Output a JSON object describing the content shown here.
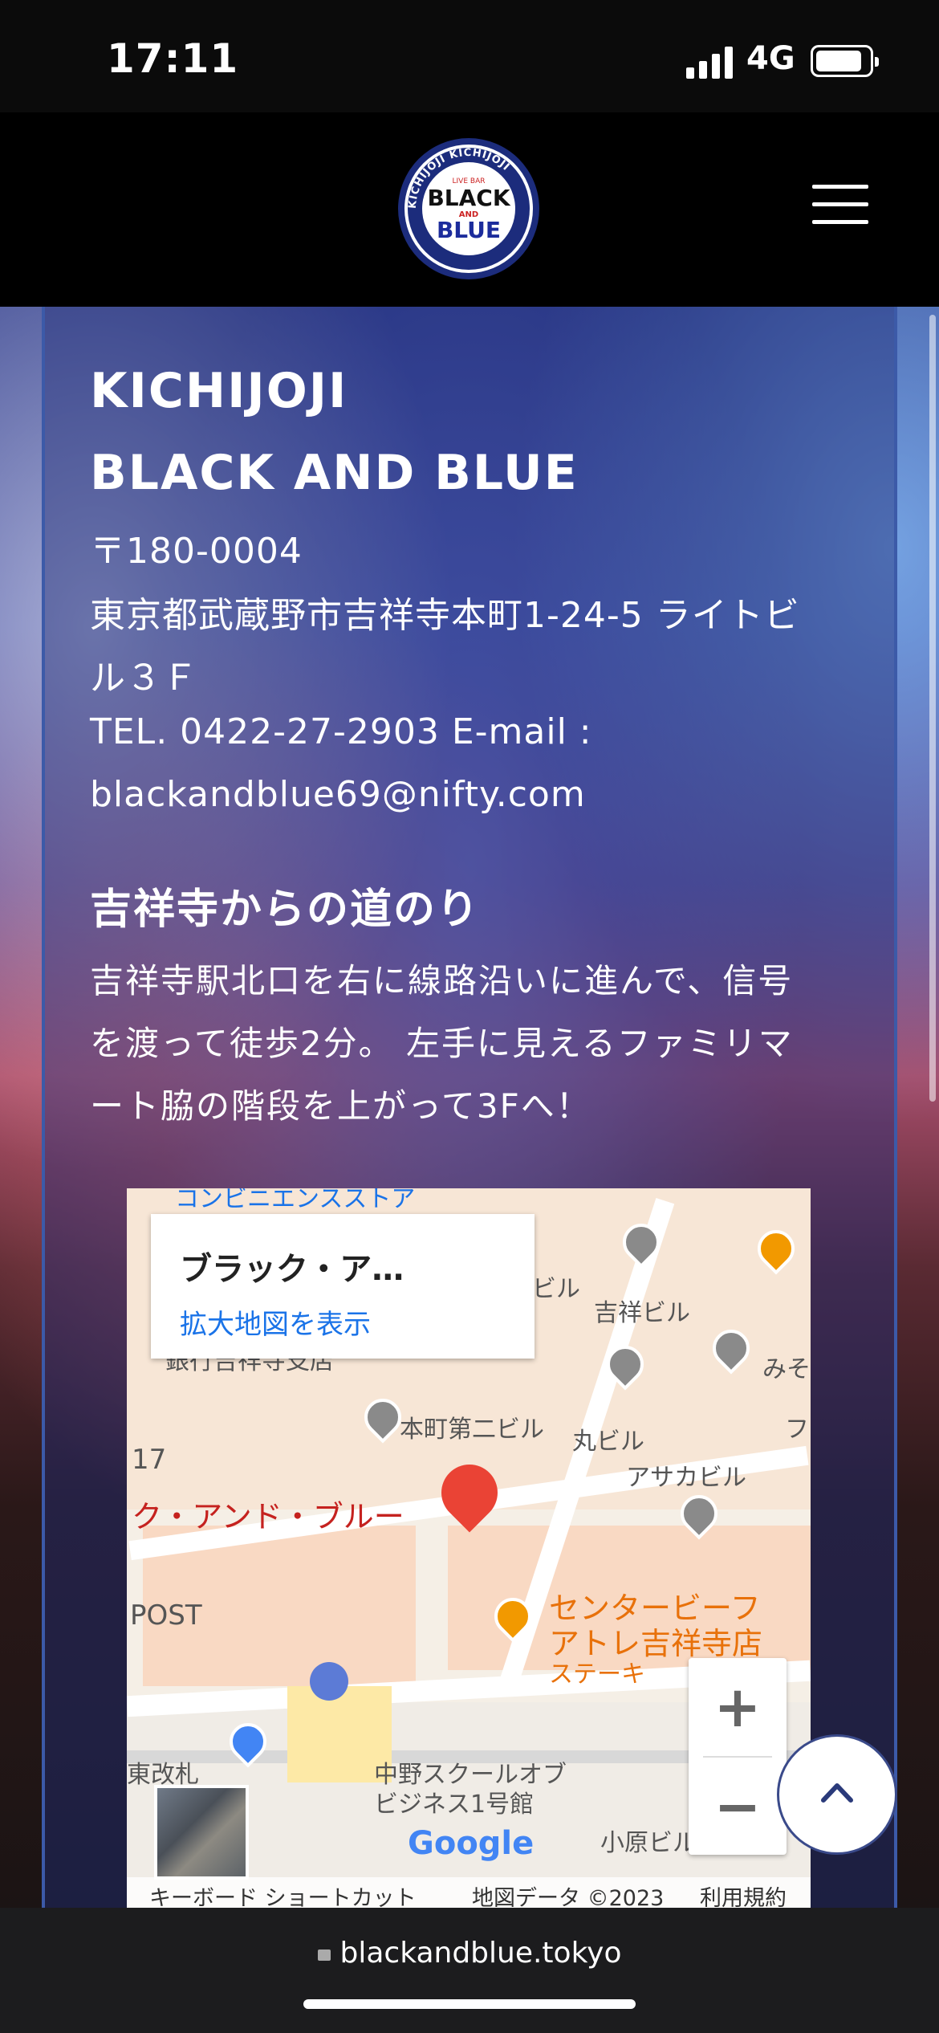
{
  "status": {
    "time": "17:11",
    "network": "4G"
  },
  "header": {
    "logo": {
      "top": "LIVE BAR",
      "line1": "BLACK",
      "line2": "AND",
      "line3": "BLUE",
      "ring": "KICHIJOJI KICHIJOJI"
    }
  },
  "info": {
    "title1": "KICHIJOJI",
    "title2": "BLACK AND BLUE",
    "postal": "〒180-0004",
    "address1": "東京都武蔵野市吉祥寺本町1-24-5 ライトビ",
    "address2": "ル３Ｆ",
    "tel_line": "TEL. 0422-27-2903 E-mail :",
    "email": "blackandblue69@nifty.com"
  },
  "directions": {
    "heading": "吉祥寺からの道のり",
    "lines": [
      "吉祥寺駅北口を右に線路沿いに進んで、信号",
      "を渡って徒歩2分。 左手に見えるファミリマ",
      "ート脇の階段を上がって3Fへ！"
    ]
  },
  "map": {
    "card_name": "ブラック・ア…",
    "card_link": "拡大地図を表示",
    "labels": {
      "store_top": "コンビニエンスストア",
      "bank": "銀行吉祥寺支店",
      "biru": "ビル",
      "kichijo": "吉祥ビル",
      "miso": "みそ",
      "honmachi": "本町第二ビル",
      "maru": "丸ビル",
      "fu": "フ",
      "asaka": "アサカビル",
      "num17": "17",
      "place": "ク・アンド・ブルー",
      "post": "POST",
      "center1": "センタービーフ",
      "center2": "アトレ吉祥寺店",
      "steak": "ステーキ",
      "east": "東改札",
      "school1": "中野スクールオブ",
      "school2": "ビジネス1号館",
      "ohara": "小原ビル"
    },
    "google": "Google",
    "zoom_in": "+",
    "zoom_out": "−",
    "attribution": {
      "shortcuts": "キーボード ショートカット",
      "data": "地図データ ©2023",
      "terms": "利用規約"
    }
  },
  "browser": {
    "url": "blackandblue.tokyo"
  }
}
